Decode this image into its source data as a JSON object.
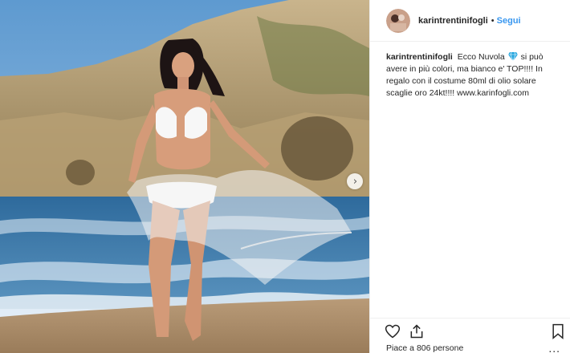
{
  "post": {
    "username": "karintrentinifogli",
    "separator": "•",
    "follow_label": "Segui",
    "caption_intro": "Ecco Nuvola",
    "caption_rest": "si può avere in più colori, ma bianco e' TOP!!!! In regalo con il costume 80ml di olio solare scaglie oro 24kt!!!! www.karinfogli.com",
    "likes_text": "Piace a 806 persone",
    "more_label": "..."
  },
  "icons": {
    "like": "heart-icon",
    "share": "share-icon",
    "save": "bookmark-icon",
    "next": "chevron-right-icon",
    "emoji": "gem-icon"
  },
  "colors": {
    "follow": "#3897f0",
    "text": "#262626",
    "border": "#efefef",
    "gem": "#29a8e0"
  }
}
